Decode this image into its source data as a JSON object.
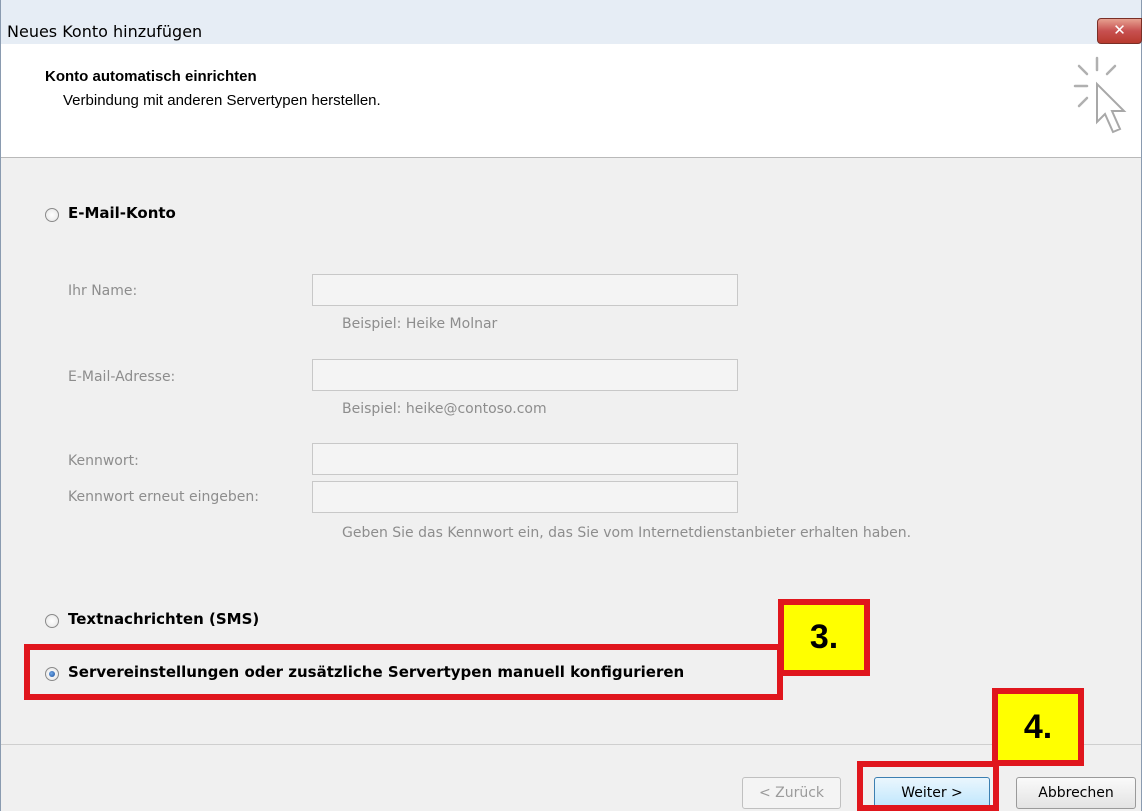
{
  "window": {
    "title": "Neues Konto hinzufügen",
    "close_label": "✕"
  },
  "header": {
    "title": "Konto automatisch einrichten",
    "subtitle": "Verbindung mit anderen Servertypen herstellen.",
    "icon": "cursor-click-icon"
  },
  "options": {
    "email": {
      "label": "E-Mail-Konto",
      "selected": false
    },
    "sms": {
      "label": "Textnachrichten (SMS)",
      "selected": false
    },
    "manual": {
      "label": "Servereinstellungen oder zusätzliche Servertypen manuell konfigurieren",
      "selected": true
    }
  },
  "form": {
    "name": {
      "label": "Ihr Name:",
      "value": "",
      "hint": "Beispiel: Heike Molnar"
    },
    "email": {
      "label": "E-Mail-Adresse:",
      "value": "",
      "hint": "Beispiel: heike@contoso.com"
    },
    "password": {
      "label": "Kennwort:",
      "value": ""
    },
    "password_repeat": {
      "label": "Kennwort erneut eingeben:",
      "value": "",
      "hint": "Geben Sie das Kennwort ein, das Sie vom Internetdienstanbieter erhalten haben."
    }
  },
  "buttons": {
    "back": "< Zurück",
    "next": "Weiter >",
    "cancel": "Abbrechen"
  },
  "annotations": {
    "step3": "3.",
    "step4": "4.",
    "color": "#e0161d",
    "badge_color": "#ffff00"
  }
}
